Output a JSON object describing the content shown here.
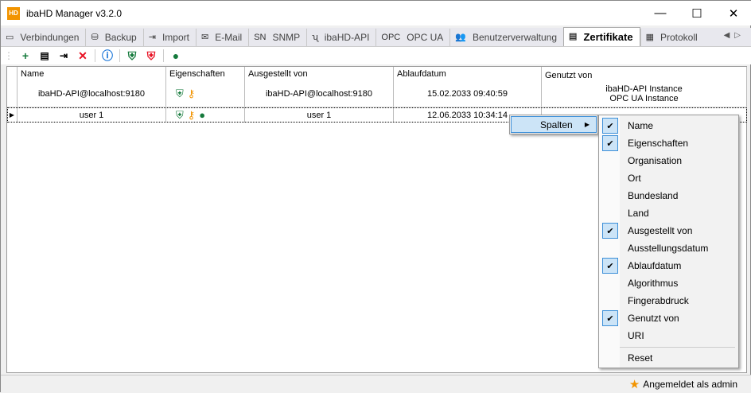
{
  "window": {
    "title": "ibaHD Manager v3.2.0",
    "logo_text": "HD"
  },
  "tabs": [
    {
      "label": "Verbindungen",
      "icon": "monitor-hd-icon",
      "glyph": "▭"
    },
    {
      "label": "Backup",
      "icon": "database-icon",
      "glyph": "⛁"
    },
    {
      "label": "Import",
      "icon": "import-icon",
      "glyph": "⇥"
    },
    {
      "label": "E-Mail",
      "icon": "envelope-icon",
      "glyph": "✉"
    },
    {
      "label": "SNMP",
      "icon": "snmp-icon",
      "glyph": "SN"
    },
    {
      "label": "ibaHD-API",
      "icon": "api-icon",
      "glyph": "ʯ"
    },
    {
      "label": "OPC UA",
      "icon": "opcua-icon",
      "glyph": "OPC"
    },
    {
      "label": "Benutzerverwaltung",
      "icon": "users-icon",
      "glyph": "👥"
    },
    {
      "label": "Zertifikate",
      "icon": "certificate-icon",
      "glyph": "▤",
      "active": true
    },
    {
      "label": "Protokoll",
      "icon": "log-icon",
      "glyph": "▦"
    }
  ],
  "grid": {
    "columns": [
      "Name",
      "Eigenschaften",
      "Ausgestellt von",
      "Ablaufdatum",
      "Genutzt von"
    ],
    "rows": [
      {
        "name": "ibaHD-API@localhost:9180",
        "issuer": "ibaHD-API@localhost:9180",
        "expiry": "15.02.2033 09:40:59",
        "used_by": [
          "ibaHD-API Instance",
          "OPC UA Instance"
        ]
      },
      {
        "name": "user 1",
        "issuer": "user 1",
        "expiry": "12.06.2033 10:34:14",
        "used_by": []
      }
    ]
  },
  "context_menu": {
    "label": "Spalten",
    "items": [
      {
        "label": "Name",
        "checked": true
      },
      {
        "label": "Eigenschaften",
        "checked": true
      },
      {
        "label": "Organisation",
        "checked": false
      },
      {
        "label": "Ort",
        "checked": false
      },
      {
        "label": "Bundesland",
        "checked": false
      },
      {
        "label": "Land",
        "checked": false
      },
      {
        "label": "Ausgestellt von",
        "checked": true
      },
      {
        "label": "Ausstellungsdatum",
        "checked": false
      },
      {
        "label": "Ablaufdatum",
        "checked": true
      },
      {
        "label": "Algorithmus",
        "checked": false
      },
      {
        "label": "Fingerabdruck",
        "checked": false
      },
      {
        "label": "Genutzt von",
        "checked": true
      },
      {
        "label": "URI",
        "checked": false
      }
    ],
    "reset": "Reset"
  },
  "status": {
    "text": "Angemeldet als admin"
  },
  "colors": {
    "accent": "#f29400",
    "green": "#157a3c",
    "red": "#e81123",
    "selection": "#cce4f7"
  }
}
